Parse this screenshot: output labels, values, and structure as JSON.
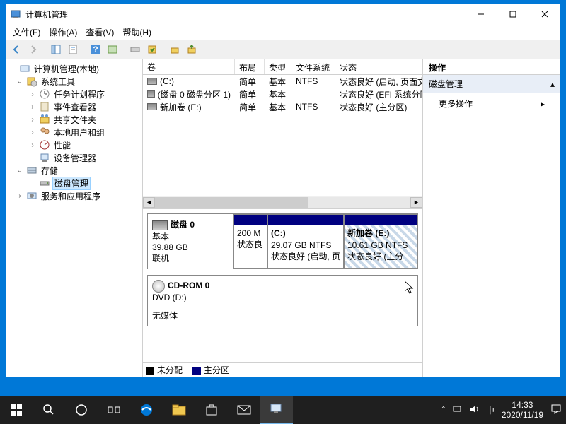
{
  "window": {
    "title": "计算机管理"
  },
  "menubar": {
    "file": "文件(F)",
    "action": "操作(A)",
    "view": "查看(V)",
    "help": "帮助(H)"
  },
  "tree": {
    "root": "计算机管理(本地)",
    "systools": "系统工具",
    "taskscheduler": "任务计划程序",
    "eventviewer": "事件查看器",
    "sharedfolders": "共享文件夹",
    "localusers": "本地用户和组",
    "performance": "性能",
    "devicemgr": "设备管理器",
    "storage": "存储",
    "diskmgmt": "磁盘管理",
    "services": "服务和应用程序"
  },
  "volumes": {
    "headers": {
      "volume": "卷",
      "layout": "布局",
      "type": "类型",
      "fs": "文件系统",
      "status": "状态"
    },
    "rows": [
      {
        "name": "(C:)",
        "layout": "简单",
        "type": "基本",
        "fs": "NTFS",
        "status": "状态良好 (启动, 页面文件"
      },
      {
        "name": "(磁盘 0 磁盘分区 1)",
        "layout": "简单",
        "type": "基本",
        "fs": "",
        "status": "状态良好 (EFI 系统分区"
      },
      {
        "name": "新加卷 (E:)",
        "layout": "简单",
        "type": "基本",
        "fs": "NTFS",
        "status": "状态良好 (主分区)"
      }
    ]
  },
  "disk0": {
    "title": "磁盘 0",
    "type": "基本",
    "size": "39.88 GB",
    "status": "联机",
    "parts": [
      {
        "label": "",
        "size": "200 M",
        "status": "状态良"
      },
      {
        "label": "(C:)",
        "size": "29.07 GB NTFS",
        "status": "状态良好 (启动, 页"
      },
      {
        "label": "新加卷  (E:)",
        "size": "10.61 GB NTFS",
        "status": "状态良好 (主分"
      }
    ]
  },
  "cdrom": {
    "title": "CD-ROM 0",
    "line1": "DVD (D:)",
    "line2": "无媒体"
  },
  "legend": {
    "unalloc": "未分配",
    "primary": "主分区"
  },
  "actions": {
    "header": "操作",
    "section": "磁盘管理",
    "more": "更多操作"
  },
  "taskbar": {
    "ime": "中",
    "time": "14:33",
    "date": "2020/11/19"
  }
}
